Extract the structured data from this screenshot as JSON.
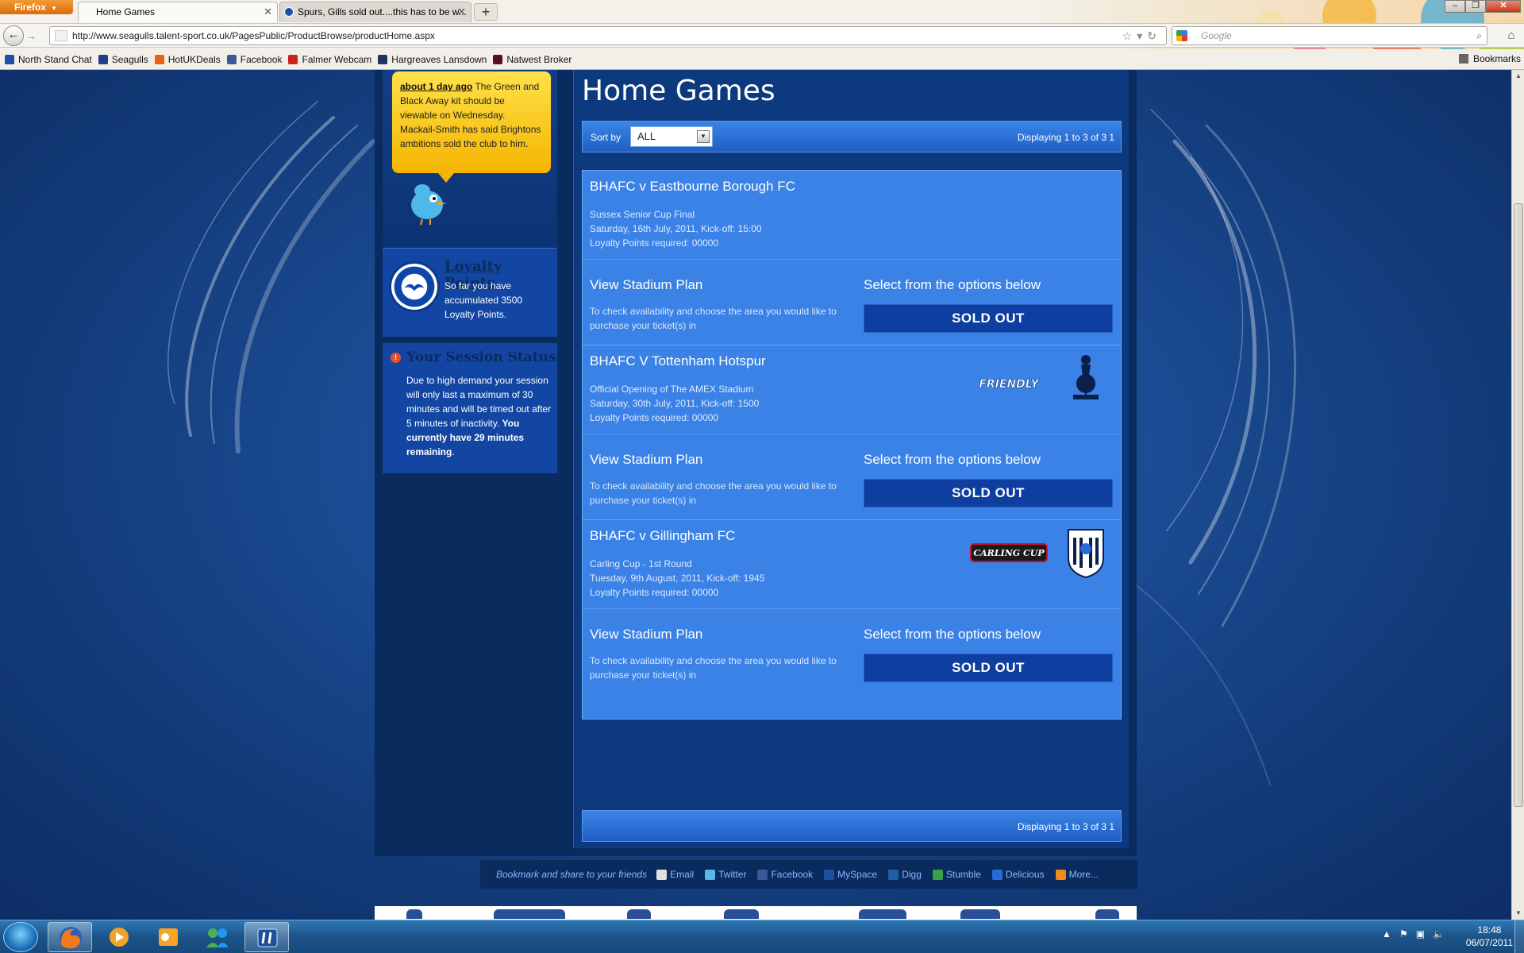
{
  "browser": {
    "menu_label": "Firefox",
    "tabs": [
      {
        "label": "Home Games",
        "active": true
      },
      {
        "label": "Spurs, Gills sold out....this has to be w...",
        "active": false
      }
    ],
    "new_tab": "+",
    "url": "http://www.seagulls.talent-sport.co.uk/PagesPublic/ProductBrowse/productHome.aspx",
    "search_placeholder": "Google",
    "bookmarks": [
      {
        "label": "North Stand Chat",
        "color": "#1d4ea8"
      },
      {
        "label": "Seagulls",
        "color": "#1d3f8a"
      },
      {
        "label": "HotUKDeals",
        "color": "#e8601a"
      },
      {
        "label": "Facebook",
        "color": "#3b5998"
      },
      {
        "label": "Falmer Webcam",
        "color": "#cc2222"
      },
      {
        "label": "Hargreaves Lansdown",
        "color": "#1f3560"
      },
      {
        "label": "Natwest Broker",
        "color": "#5a0d2a"
      }
    ],
    "bookmarks_menu": "Bookmarks"
  },
  "sidebar": {
    "tweet": {
      "time": "about 1 day ago",
      "text": " The Green and Black Away kit should be viewable on Wednesday. Mackail-Smith has said Brightons ambitions sold the club to him."
    },
    "loyalty": {
      "title": "Loyalty Points",
      "text": "So far you have accumulated 3500 Loyalty Points."
    },
    "session": {
      "title": "Your Session Status",
      "text": "Due to high demand your session will only last a maximum of 30 minutes and will be timed out after 5 minutes of inactivity. ",
      "bold": "You currently have 29 minutes remaining",
      "end": "."
    }
  },
  "main": {
    "title": "Home Games",
    "sort_label": "Sort by",
    "sort_value": "ALL",
    "display_count": "Displaying 1 to 3 of 3 1",
    "games": [
      {
        "title": "BHAFC v Eastbourne Borough FC",
        "competition": "Sussex Senior Cup Final",
        "date": "Saturday, 16th July, 2011, Kick-off: 15:00",
        "points": "Loyalty Points required: 00000",
        "badge": "",
        "stadium_title": "View Stadium Plan",
        "stadium_desc": "To check availability and choose the area you would like to purchase your ticket(s) in",
        "select_title": "Select from the options below",
        "status": "SOLD OUT"
      },
      {
        "title": "BHAFC V Tottenham Hotspur",
        "competition": "Official Opening of The AMEX Stadium",
        "date": "Saturday, 30th July, 2011, Kick-off: 1500",
        "points": "Loyalty Points required: 00000",
        "badge": "FRIENDLY",
        "stadium_title": "View Stadium Plan",
        "stadium_desc": "To check availability and choose the area you would like to purchase your ticket(s) in",
        "select_title": "Select from the options below",
        "status": "SOLD OUT"
      },
      {
        "title": "BHAFC v Gillingham FC",
        "competition": "Carling Cup - 1st Round",
        "date": "Tuesday, 9th August, 2011, Kick-off: 1945",
        "points": "Loyalty Points required: 00000",
        "badge": "CARLING CUP",
        "stadium_title": "View Stadium Plan",
        "stadium_desc": "To check availability and choose the area you would like to purchase your ticket(s) in",
        "select_title": "Select from the options below",
        "status": "SOLD OUT"
      }
    ]
  },
  "footer": {
    "share_label": "Bookmark and share to your friends",
    "links": [
      {
        "label": "Email",
        "color": "#e0e0e0"
      },
      {
        "label": "Twitter",
        "color": "#5ab4ea"
      },
      {
        "label": "Facebook",
        "color": "#3b5998"
      },
      {
        "label": "MySpace",
        "color": "#1e4e9e"
      },
      {
        "label": "Digg",
        "color": "#1e5fa8"
      },
      {
        "label": "Stumble",
        "color": "#3aa34a"
      },
      {
        "label": "Delicious",
        "color": "#2a6ad6"
      },
      {
        "label": "More...",
        "color": "#f08a1a"
      }
    ]
  },
  "taskbar": {
    "time": "18:48",
    "date": "06/07/2011"
  },
  "colors": {
    "accent": "#3a82e6",
    "sold_out": "#0d3ea0",
    "page_bg": "#123a78"
  }
}
